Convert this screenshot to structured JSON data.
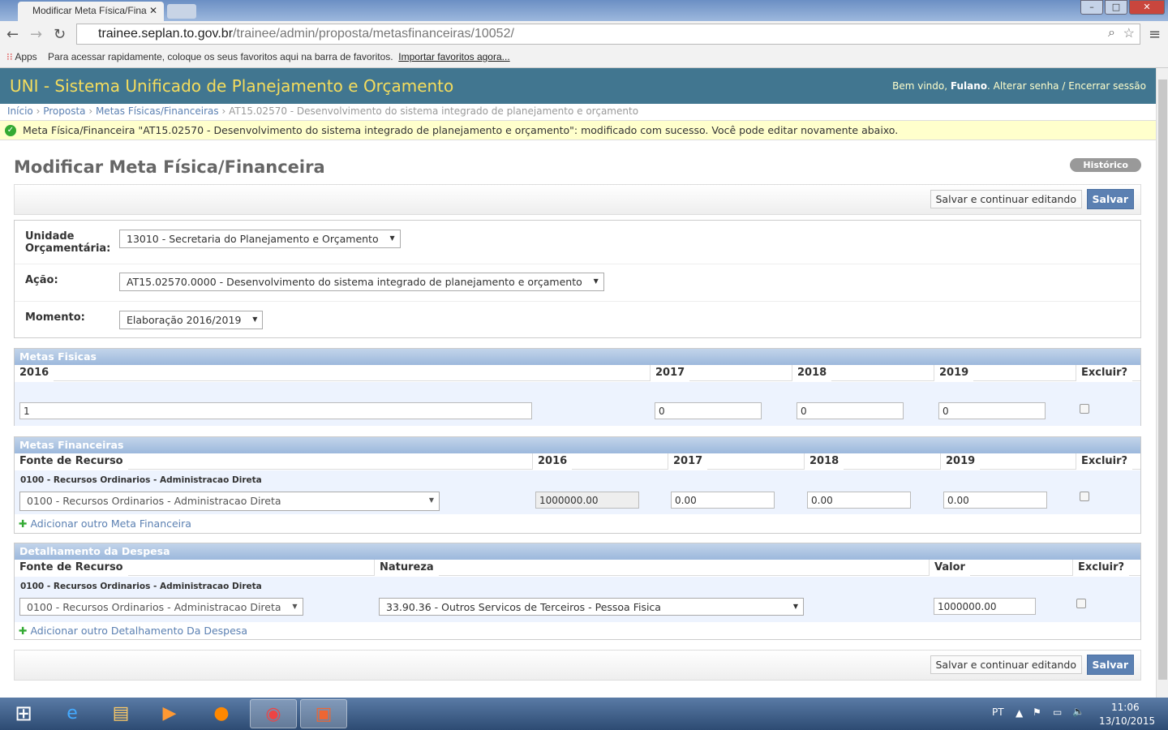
{
  "browser": {
    "tab_title": "Modificar Meta Física/Fina",
    "url_host": "trainee.seplan.to.gov.br",
    "url_path": "/trainee/admin/proposta/metasfinanceiras/10052/",
    "bookmarks": {
      "apps": "Apps",
      "hint": "Para acessar rapidamente, coloque os seus favoritos aqui na barra de favoritos.",
      "import": "Importar favoritos agora..."
    }
  },
  "header": {
    "title": "UNI - Sistema Unificado de Planejamento e Orçamento",
    "welcome": "Bem vindo,",
    "user": "Fulano",
    "change_password": "Alterar senha",
    "logout": "Encerrar sessão",
    "sep": "/"
  },
  "breadcrumb": [
    "Início",
    "Proposta",
    "Metas Físicas/Financeiras",
    "AT15.02570 - Desenvolvimento do sistema integrado de planejamento e orçamento"
  ],
  "message": "Meta Física/Financeira \"AT15.02570 - Desenvolvimento do sistema integrado de planejamento e orçamento\": modificado com sucesso. Você pode editar novamente abaixo.",
  "page": {
    "title": "Modificar Meta Física/Financeira",
    "history": "Histórico",
    "save_continue": "Salvar e continuar editando",
    "save": "Salvar"
  },
  "form": {
    "unidade_label": "Unidade Orçamentária:",
    "unidade_value": "13010 - Secretaria do Planejamento e Orçamento",
    "acao_label": "Ação:",
    "acao_value": "AT15.02570.0000 - Desenvolvimento do sistema integrado de planejamento e orçamento",
    "momento_label": "Momento:",
    "momento_value": "Elaboração 2016/2019"
  },
  "metas_fisicas": {
    "caption": "Metas Fisicas",
    "headers": [
      "2016",
      "2017",
      "2018",
      "2019",
      "Excluir?"
    ],
    "values": [
      "1",
      "0",
      "0",
      "0"
    ]
  },
  "metas_financeiras": {
    "caption": "Metas Financeiras",
    "headers": [
      "Fonte de Recurso",
      "2016",
      "2017",
      "2018",
      "2019",
      "Excluir?"
    ],
    "row_label": "0100 - Recursos Ordinarios - Administracao Direta",
    "fonte": "0100 - Recursos Ordinarios - Administracao Direta",
    "values": [
      "1000000.00",
      "0.00",
      "0.00",
      "0.00"
    ],
    "add": "Adicionar outro Meta Financeira"
  },
  "detalhamento": {
    "caption": "Detalhamento da Despesa",
    "headers": [
      "Fonte de Recurso",
      "Natureza",
      "Valor",
      "Excluir?"
    ],
    "row_label": "0100 - Recursos Ordinarios - Administracao Direta",
    "fonte": "0100 - Recursos Ordinarios - Administracao Direta",
    "natureza": "33.90.36 - Outros Servicos de Terceiros - Pessoa Fisica",
    "valor": "1000000.00",
    "add": "Adicionar outro Detalhamento Da Despesa"
  },
  "taskbar": {
    "lang": "PT",
    "time": "11:06",
    "date": "13/10/2015"
  }
}
